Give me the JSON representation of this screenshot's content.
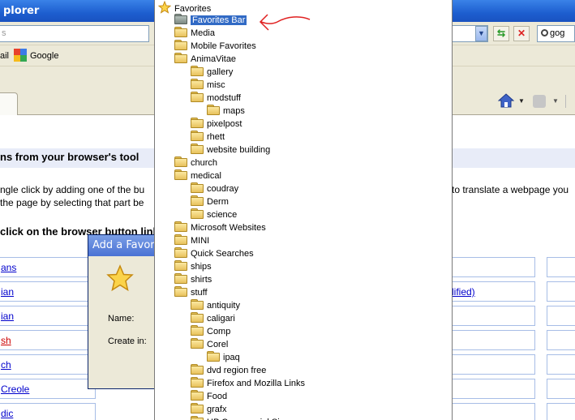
{
  "window": {
    "title": "plorer"
  },
  "address": {
    "value": "s",
    "search_value": "gog"
  },
  "links": {
    "mail_label": "ail",
    "google_label": "Google"
  },
  "page": {
    "heading": "ns from your browser's tool",
    "line1": "ngle click by adding one of the bu",
    "line1_right": "to translate a webpage you",
    "line2": " the page by selecting that part be",
    "line3": "click on the browser button link",
    "languages": [
      "ans",
      "ian",
      "ian",
      "sh",
      "ch",
      "Creole",
      "dic"
    ],
    "red_language_index": 3,
    "mid_cells": [
      "",
      "lified)",
      "",
      "",
      "",
      "",
      ""
    ]
  },
  "dialog": {
    "title": "Add a Favorite",
    "name_label": "Name:",
    "create_in_label": "Create in:"
  },
  "favorites": {
    "items": [
      {
        "label": "Favorites",
        "level": 0,
        "icon": "star-icon",
        "selected": false
      },
      {
        "label": "Favorites Bar",
        "level": 1,
        "icon": "folder-icon",
        "selected": true
      },
      {
        "label": "Media",
        "level": 1,
        "icon": "folder-icon",
        "selected": false
      },
      {
        "label": "Mobile Favorites",
        "level": 1,
        "icon": "folder-icon",
        "selected": false
      },
      {
        "label": "AnimaVitae",
        "level": 1,
        "icon": "folder-icon",
        "selected": false
      },
      {
        "label": "gallery",
        "level": 2,
        "icon": "folder-icon",
        "selected": false
      },
      {
        "label": "misc",
        "level": 2,
        "icon": "folder-icon",
        "selected": false
      },
      {
        "label": "modstuff",
        "level": 2,
        "icon": "folder-icon",
        "selected": false
      },
      {
        "label": "maps",
        "level": 3,
        "icon": "folder-icon",
        "selected": false
      },
      {
        "label": "pixelpost",
        "level": 2,
        "icon": "folder-icon",
        "selected": false
      },
      {
        "label": "rhett",
        "level": 2,
        "icon": "folder-icon",
        "selected": false
      },
      {
        "label": "website building",
        "level": 2,
        "icon": "folder-icon",
        "selected": false
      },
      {
        "label": "church",
        "level": 1,
        "icon": "folder-icon",
        "selected": false
      },
      {
        "label": "medical",
        "level": 1,
        "icon": "folder-icon",
        "selected": false
      },
      {
        "label": "coudray",
        "level": 2,
        "icon": "folder-icon",
        "selected": false
      },
      {
        "label": "Derm",
        "level": 2,
        "icon": "folder-icon",
        "selected": false
      },
      {
        "label": "science",
        "level": 2,
        "icon": "folder-icon",
        "selected": false
      },
      {
        "label": "Microsoft Websites",
        "level": 1,
        "icon": "folder-icon",
        "selected": false
      },
      {
        "label": "MINI",
        "level": 1,
        "icon": "folder-icon",
        "selected": false
      },
      {
        "label": "Quick Searches",
        "level": 1,
        "icon": "folder-icon",
        "selected": false
      },
      {
        "label": "ships",
        "level": 1,
        "icon": "folder-icon",
        "selected": false
      },
      {
        "label": "shirts",
        "level": 1,
        "icon": "folder-icon",
        "selected": false
      },
      {
        "label": "stuff",
        "level": 1,
        "icon": "folder-icon",
        "selected": false
      },
      {
        "label": "antiquity",
        "level": 2,
        "icon": "folder-icon",
        "selected": false
      },
      {
        "label": "caligari",
        "level": 2,
        "icon": "folder-icon",
        "selected": false
      },
      {
        "label": "Comp",
        "level": 2,
        "icon": "folder-icon",
        "selected": false
      },
      {
        "label": "Corel",
        "level": 2,
        "icon": "folder-icon",
        "selected": false
      },
      {
        "label": "ipaq",
        "level": 3,
        "icon": "folder-icon",
        "selected": false
      },
      {
        "label": "dvd region free",
        "level": 2,
        "icon": "folder-icon",
        "selected": false
      },
      {
        "label": "Firefox and Mozilla Links",
        "level": 2,
        "icon": "folder-icon",
        "selected": false
      },
      {
        "label": "Food",
        "level": 2,
        "icon": "folder-icon",
        "selected": false
      },
      {
        "label": "grafx",
        "level": 2,
        "icon": "folder-icon",
        "selected": false
      },
      {
        "label": "HP Commercial Si",
        "level": 2,
        "icon": "folder-icon",
        "selected": false
      }
    ]
  },
  "colors": {
    "selection": "#316ac5",
    "annotation_arrow": "#e02020",
    "title_bar": "#1d5ecf"
  }
}
